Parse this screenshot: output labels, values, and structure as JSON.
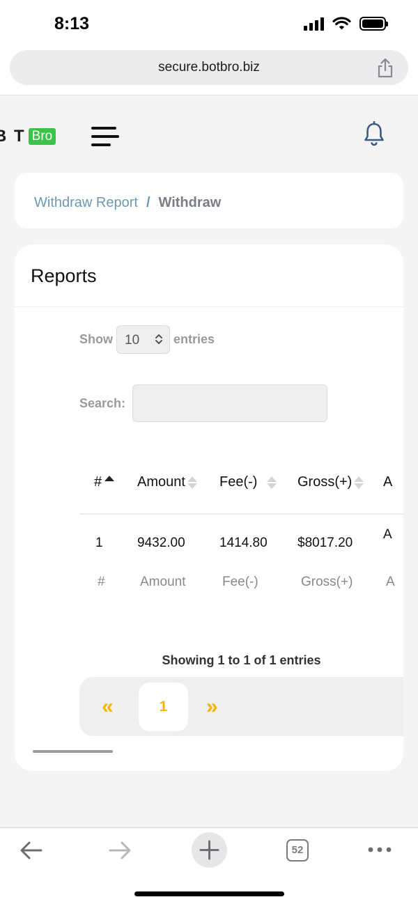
{
  "status_bar": {
    "time": "8:13"
  },
  "browser": {
    "url": "secure.botbro.biz"
  },
  "header": {
    "logo_text": "B  T",
    "logo_badge": "Bro"
  },
  "breadcrumb": {
    "parent": "Withdraw Report",
    "separator": "/",
    "current": "Withdraw"
  },
  "reports": {
    "title": "Reports",
    "show_label": "Show",
    "entries_value": "10",
    "entries_label": "entries",
    "search_label": "Search:",
    "search_value": "",
    "columns": [
      "#",
      "Amount",
      "Fee(-)",
      "Gross(+)",
      "A"
    ],
    "rows": [
      {
        "index": "1",
        "amount": "9432.00",
        "fee": "1414.80",
        "gross": "$8017.20",
        "extra": "A"
      }
    ],
    "footer_columns": [
      "#",
      "Amount",
      "Fee(-)",
      "Gross(+)",
      "A"
    ],
    "info": "Showing 1 to 1 of 1 entries",
    "pagination": {
      "prev": "«",
      "current_page": "1",
      "next": "»"
    }
  },
  "toolbar": {
    "tab_count": "52"
  }
}
